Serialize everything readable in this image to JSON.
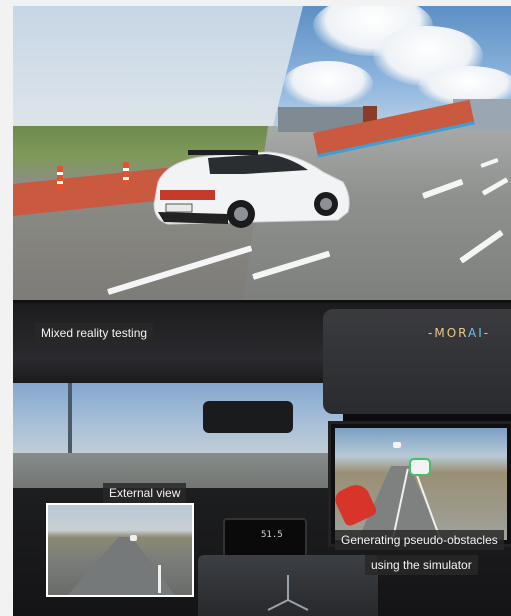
{
  "top_panel": {
    "description_hidden": ""
  },
  "bottom_panel": {
    "label_mixed_reality": "Mixed reality testing",
    "label_external_view": "External view",
    "label_pseudo_obstacles_line1": "Generating pseudo-obstacles",
    "label_pseudo_obstacles_line2": "using the simulator",
    "brand_part1": "MOR",
    "brand_part2": "AI",
    "brand_prefix": "-",
    "brand_suffix": "-",
    "dash_readout": "51.5"
  },
  "colors": {
    "bike_lane": "#c95a3f",
    "lane_edge_blue": "#3aa0d8",
    "brand_gold": "#e7c889",
    "brand_cyan": "#6ec6e8",
    "virtual_car_red": "#d8342a"
  }
}
